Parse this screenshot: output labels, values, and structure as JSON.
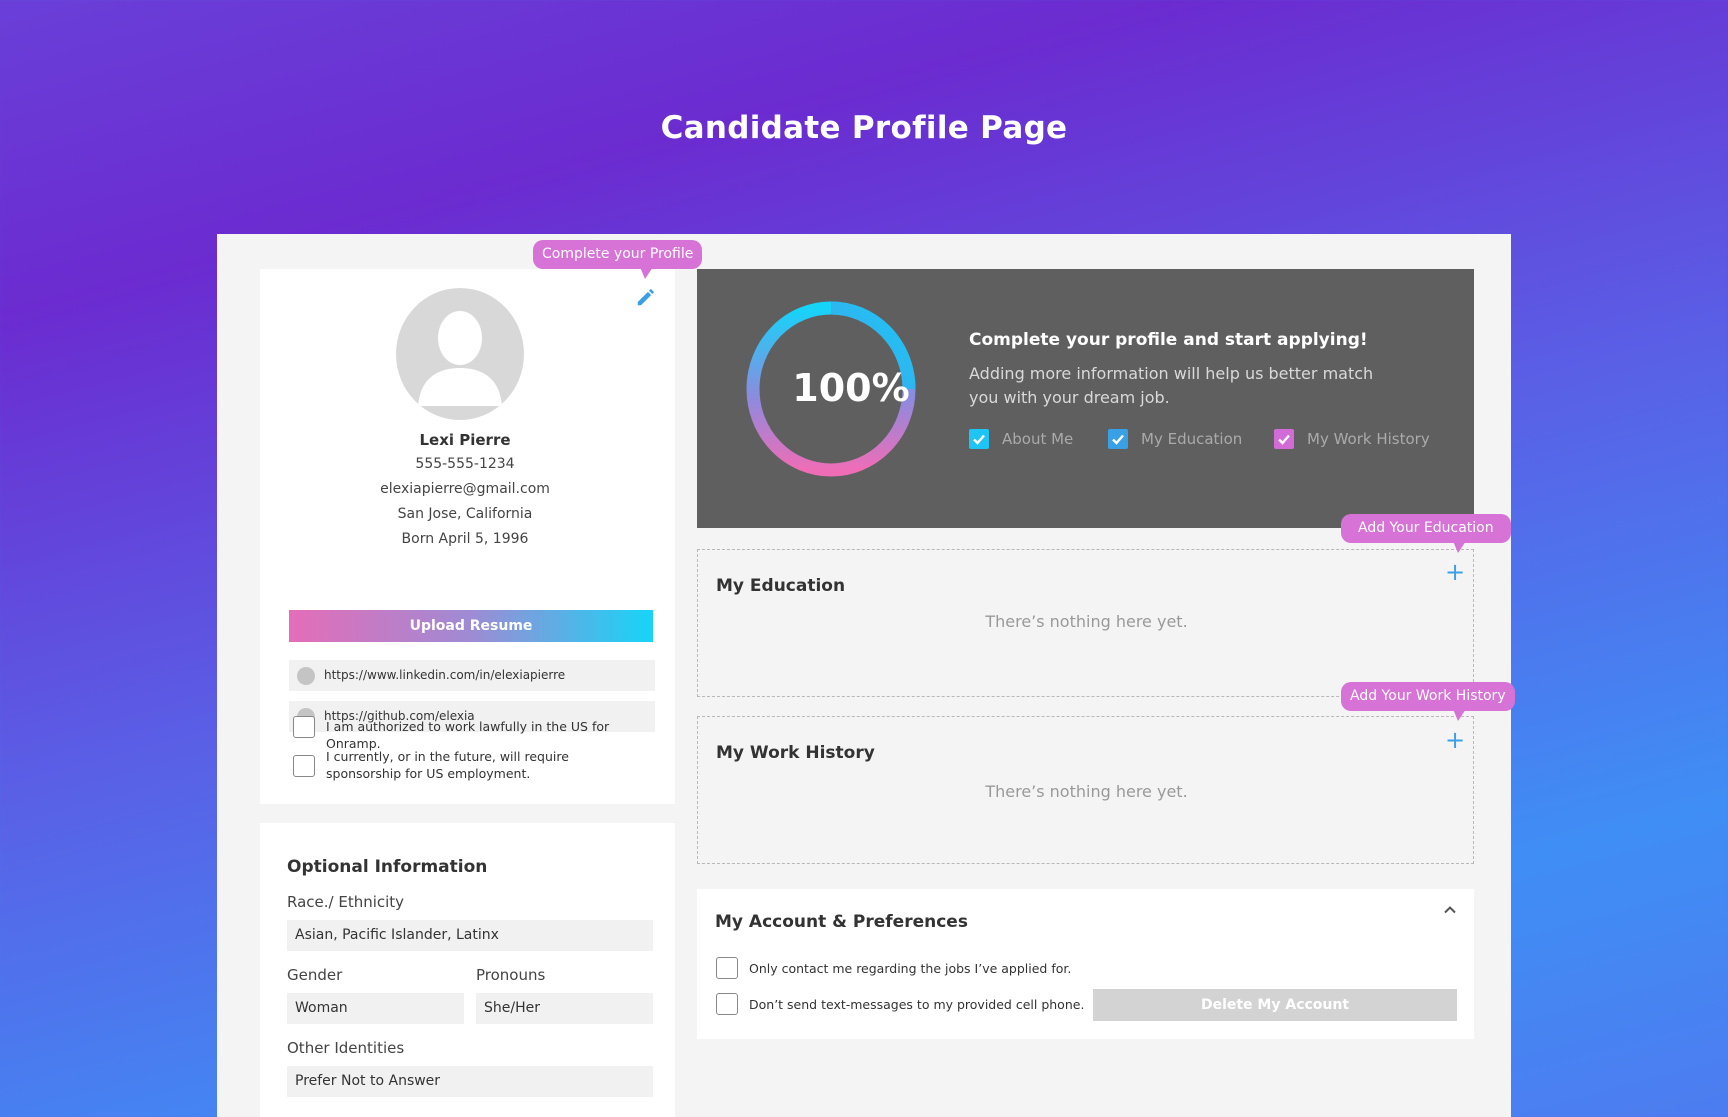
{
  "header": {
    "title": "Candidate Profile Page"
  },
  "profile": {
    "name": "Lexi Pierre",
    "phone": "555-555-1234",
    "email": "elexiapierre@gmail.com",
    "location": "San Jose,  California",
    "birth": "Born April 5, 1996",
    "upload_label": "Upload Resume",
    "links": [
      "https://www.linkedin.com/in/elexiapierre",
      "https://github.com/elexia"
    ],
    "checkboxes": [
      "I am authorized to work lawfully in the US for Onramp.",
      "I currently, or in the future, will require sponsorship for US employment."
    ],
    "edit_icon": "pencil-icon"
  },
  "optional": {
    "title": "Optional Information",
    "race_label": "Race./ Ethnicity",
    "race_value": "Asian, Pacific Islander, Latinx",
    "gender_label": "Gender",
    "gender_value": "Woman",
    "pronouns_label": "Pronouns",
    "pronouns_value": "She/Her",
    "other_label": "Other Identities",
    "other_value": "Prefer Not to Answer"
  },
  "progress": {
    "percent_text": "100%",
    "percent": 100,
    "title": "Complete your profile and start applying!",
    "subtitle": "Adding more information will help us better match you with your dream job.",
    "items": [
      {
        "label": "About Me",
        "checked": true,
        "color": "#1ec4f4"
      },
      {
        "label": "My Education",
        "checked": true,
        "color": "#3aa0e6"
      },
      {
        "label": "My Work History",
        "checked": true,
        "color": "#d26ad7"
      }
    ]
  },
  "education": {
    "title": "My Education",
    "empty": "There’s nothing here yet."
  },
  "work": {
    "title": "My Work History",
    "empty": "There’s nothing here yet."
  },
  "account": {
    "title": "My Account & Preferences",
    "options": [
      "Only contact me regarding the jobs I’ve applied for.",
      "Don’t send text-messages to my provided cell phone."
    ],
    "delete_label": "Delete My Account"
  },
  "tooltips": {
    "profile": "Complete your Profile",
    "education": "Add Your Education",
    "work": "Add Your Work History"
  },
  "colors": {
    "accent_blue": "#3aa0e6",
    "tooltip_pink": "#d772d6",
    "progress_bg": "#5f5f5f"
  }
}
